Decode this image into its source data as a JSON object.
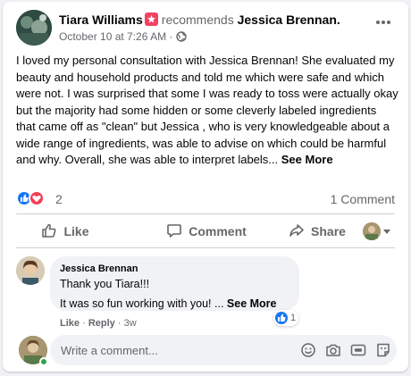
{
  "post": {
    "author": "Tiara Williams",
    "recommends_text": "recommends",
    "recommended_page": "Jessica Brennan.",
    "timestamp": "October 10 at 7:26 AM",
    "dot_sep": "·",
    "body": "I loved my personal consultation with Jessica Brennan! She evaluated my beauty and household products and told me which were safe and which were not. I was surprised that some I was ready to toss were actually okay but the majority had some hidden or some cleverly labeled ingredients that came off as \"clean\" but Jessica , who is very knowledgeable about a wide range of ingredients, was able to advise on which could be harmful and why. Overall, she was able to interpret labels...",
    "see_more": "See More"
  },
  "reactions": {
    "count": "2",
    "comments": "1 Comment",
    "types": [
      "like-icon",
      "love-icon"
    ]
  },
  "actions": {
    "like": "Like",
    "comment": "Comment",
    "share": "Share"
  },
  "comment": {
    "author": "Jessica Brennan",
    "line1": "Thank you Tiara!!!",
    "line2": "It was so fun working with you! ...",
    "see_more": "See More",
    "reaction_count": "1",
    "like_label": "Like",
    "reply_label": "Reply",
    "sep": "·",
    "age": "3w"
  },
  "composer": {
    "placeholder": "Write a comment...",
    "icons": [
      "emoji-icon",
      "camera-icon",
      "gif-icon",
      "sticker-icon"
    ]
  },
  "colors": {
    "accent": "#1877f2",
    "love": "#f33e58",
    "recommend_badge": "#f3425f",
    "muted_text": "#65676b",
    "online": "#31a24c"
  }
}
